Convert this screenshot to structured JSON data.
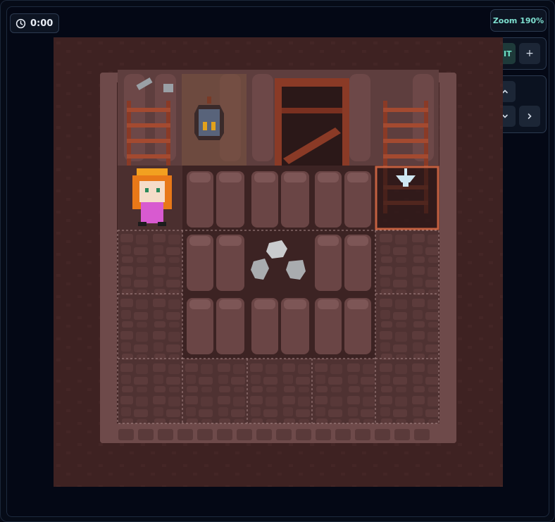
{
  "timer": {
    "text": "0:00",
    "icon": "clock-icon"
  },
  "zoom": {
    "label": "Zoom 190%"
  },
  "zoom_controls": {
    "minus": "−",
    "fit": "FIT",
    "plus": "+"
  },
  "direction_controls": {
    "up": "˄",
    "left": "‹",
    "down": "˅",
    "right": "›"
  },
  "game": {
    "grid_columns": 7,
    "grid_rows": 7,
    "player": {
      "col": 1,
      "row": 2,
      "sprite": "princess-girl-pink-dress"
    },
    "items": [
      {
        "name": "ladder",
        "col": 1,
        "row": 1
      },
      {
        "name": "lantern",
        "col": 2,
        "row": 1
      },
      {
        "name": "mine-shaft-stairs",
        "col": 4,
        "row": 1
      },
      {
        "name": "ladder",
        "col": 5,
        "row": 1
      },
      {
        "name": "ladder-exit-goal",
        "col": 5,
        "row": 2
      },
      {
        "name": "rocks-pile",
        "col": 3,
        "row": 3
      }
    ],
    "colors": {
      "background": "#3e2222",
      "wall": "#6e4a4a",
      "rock": "#5a3838",
      "floor": "#4f3232",
      "path": "#644242",
      "highlight": "#c36040",
      "accent": "#7ee0d0"
    }
  }
}
